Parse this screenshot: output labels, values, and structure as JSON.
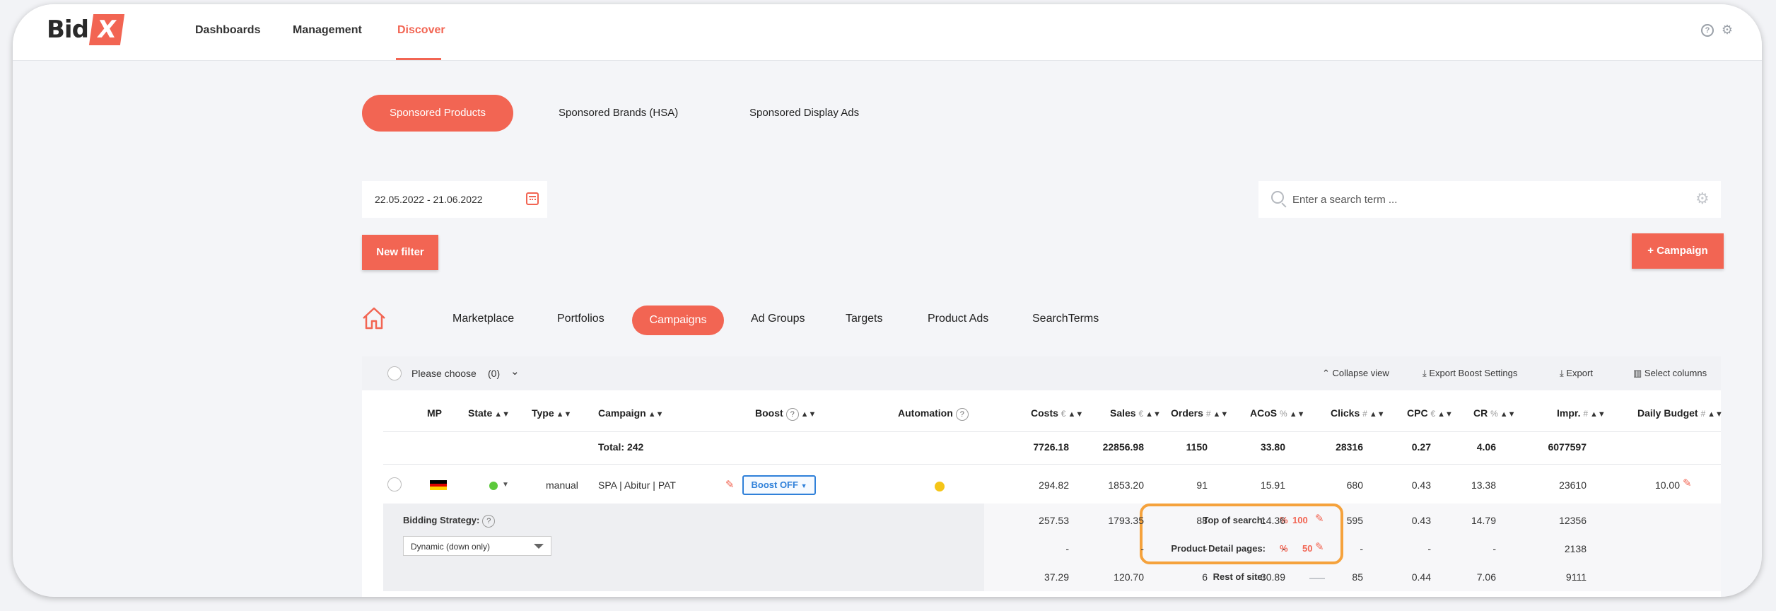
{
  "app": {
    "logo_text": "Bid",
    "logo_mark": "X"
  },
  "nav": {
    "items": [
      "Dashboards",
      "Management",
      "Discover"
    ],
    "active": "Discover"
  },
  "ad_types": {
    "items": [
      "Sponsored Products",
      "Sponsored Brands (HSA)",
      "Sponsored Display Ads"
    ],
    "active": "Sponsored Products"
  },
  "filters": {
    "date_range": "22.05.2022 - 21.06.2022",
    "search_placeholder": "Enter a search term ...",
    "new_filter_label": "New filter",
    "add_campaign_label": "+ Campaign"
  },
  "tabs": {
    "items": [
      "Marketplace",
      "Portfolios",
      "Campaigns",
      "Ad Groups",
      "Targets",
      "Product Ads",
      "SearchTerms"
    ],
    "active": "Campaigns"
  },
  "toolbar": {
    "choose_label": "Please choose",
    "choose_count": "(0)",
    "collapse_label": "Collapse view",
    "export_boost_label": "Export Boost Settings",
    "export_label": "Export",
    "select_columns_label": "Select columns"
  },
  "table": {
    "headers": {
      "mp": "MP",
      "state": "State",
      "type": "Type",
      "campaign": "Campaign",
      "boost": "Boost",
      "automation": "Automation",
      "costs": "Costs",
      "costs_unit": "€",
      "sales": "Sales",
      "sales_unit": "€",
      "orders": "Orders",
      "orders_unit": "#",
      "acos": "ACoS",
      "acos_unit": "%",
      "clicks": "Clicks",
      "clicks_unit": "#",
      "cpc": "CPC",
      "cpc_unit": "€",
      "cr": "CR",
      "cr_unit": "%",
      "impr": "Impr.",
      "impr_unit": "#",
      "budget": "Daily Budget",
      "budget_unit": "#"
    },
    "totals": {
      "label": "Total: 242",
      "costs": "7726.18",
      "sales": "22856.98",
      "orders": "1150",
      "acos": "33.80",
      "clicks": "28316",
      "cpc": "0.27",
      "cr": "4.06",
      "impr": "6077597"
    },
    "row": {
      "type": "manual",
      "campaign": "SPA | Abitur | PAT",
      "boost": "Boost OFF",
      "state_color": "#5cc93b",
      "automation_color": "#f5c518",
      "costs": "294.82",
      "sales": "1853.20",
      "orders": "91",
      "acos": "15.91",
      "clicks": "680",
      "cpc": "0.43",
      "cr": "13.38",
      "impr": "23610",
      "budget": "10.00"
    },
    "bidding": {
      "label": "Bidding Strategy:",
      "strategy": "Dynamic (down only)",
      "placements": [
        {
          "label": "Top of search:",
          "pct_sign": "%",
          "value": "100",
          "costs": "257.53",
          "sales": "1793.35",
          "orders": "88",
          "acos": "14.36",
          "clicks": "595",
          "cpc": "0.43",
          "cr": "14.79",
          "impr": "12356"
        },
        {
          "label": "Product Detail pages:",
          "pct_sign": "%",
          "value": "50",
          "costs": "-",
          "sales": "-",
          "orders": "-",
          "acos": "-",
          "clicks": "-",
          "cpc": "-",
          "cr": "-",
          "impr": "2138"
        },
        {
          "label": "Rest of site:",
          "pct_sign": "",
          "value": "",
          "costs": "37.29",
          "sales": "120.70",
          "orders": "6",
          "acos": "30.89",
          "clicks": "85",
          "cpc": "0.44",
          "cr": "7.06",
          "impr": "9111"
        }
      ]
    }
  }
}
